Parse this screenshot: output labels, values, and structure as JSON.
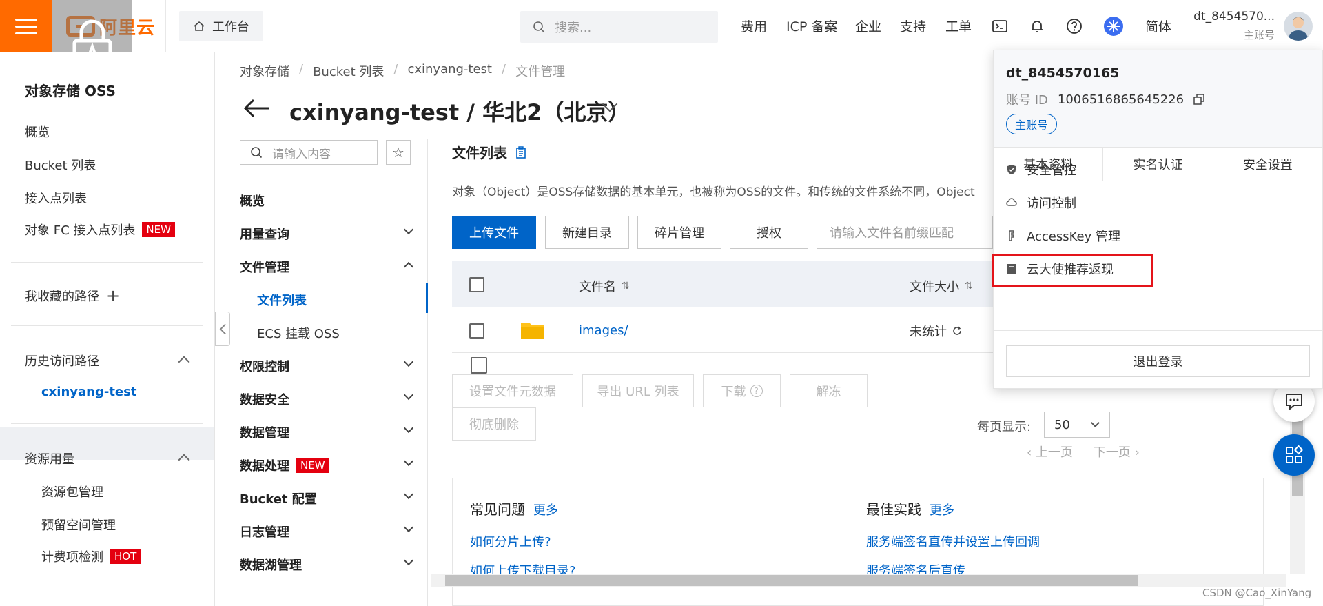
{
  "topbar": {
    "logo_text": "阿里云",
    "workbench": "工作台",
    "search_placeholder": "搜索...",
    "nav": [
      "费用",
      "ICP 备案",
      "企业",
      "支持",
      "工单"
    ],
    "lang": "简体",
    "user_name": "dt_8454570...",
    "user_role": "主账号",
    "brand_color": "#ff6a00"
  },
  "sidebar": {
    "title": "对象存储 OSS",
    "items": [
      "概览",
      "Bucket 列表",
      "接入点列表"
    ],
    "fc_item": "对象 FC 接入点列表",
    "badge_new": "NEW",
    "favorites": "我收藏的路径",
    "history": "历史访问路径",
    "history_item": "cxinyang-test",
    "resource_usage": "资源用量",
    "resource_items": [
      "资源包管理",
      "预留空间管理"
    ],
    "billing_check": "计费项检测",
    "badge_hot": "HOT"
  },
  "breadcrumb": [
    "对象存储",
    "Bucket 列表",
    "cxinyang-test",
    "文件管理"
  ],
  "title": "cxinyang-test / 华北2（北京）",
  "nav2": {
    "search_placeholder": "请输入内容",
    "items": {
      "overview": "概览",
      "usage": "用量查询",
      "file_mgmt": "文件管理",
      "file_list": "文件列表",
      "ecs_mount": "ECS 挂载 OSS",
      "permission": "权限控制",
      "data_security": "数据安全",
      "data_mgmt": "数据管理",
      "data_proc": "数据处理",
      "data_proc_badge": "NEW",
      "bucket_config": "Bucket 配置",
      "log_mgmt": "日志管理",
      "data_lake": "数据湖管理"
    }
  },
  "main": {
    "section_title": "文件列表",
    "description": "对象（Object）是OSS存储数据的基本单元，也被称为OSS的文件。和传统的文件系统不同，Object",
    "buttons": {
      "upload": "上传文件",
      "new_dir": "新建目录",
      "fragments": "碎片管理",
      "authorize": "授权"
    },
    "prefix_placeholder": "请输入文件名前缀匹配",
    "table": {
      "col_name": "文件名",
      "col_size": "文件大小",
      "rows": [
        {
          "name": "images/",
          "size": "未统计"
        }
      ]
    },
    "bulk": {
      "set_meta": "设置文件元数据",
      "export_url": "导出 URL 列表",
      "download": "下载",
      "unfreeze": "解冻",
      "delete": "彻底删除"
    },
    "pagination": {
      "per_page_label": "每页显示:",
      "per_page_value": "50",
      "prev": "上一页",
      "next": "下一页"
    }
  },
  "help": {
    "faq_title": "常见问题",
    "faq_more": "更多",
    "faq_links": [
      "如何分片上传?",
      "如何上传下载目录?"
    ],
    "best_title": "最佳实践",
    "best_more": "更多",
    "best_links": [
      "服务端签名直传并设置上传回调",
      "服务端签名后直传"
    ]
  },
  "dropdown": {
    "name": "dt_8454570165",
    "acct_label": "账号 ID",
    "acct_id": "1006516865645226",
    "role": "主账号",
    "tabs": [
      "基本资料",
      "实名认证",
      "安全设置"
    ],
    "items": [
      "安全管控",
      "访问控制",
      "AccessKey 管理",
      "云大使推荐返现"
    ],
    "logout": "退出登录",
    "highlight_color": "#e4141a"
  },
  "watermark": "CSDN @Cao_XinYang"
}
